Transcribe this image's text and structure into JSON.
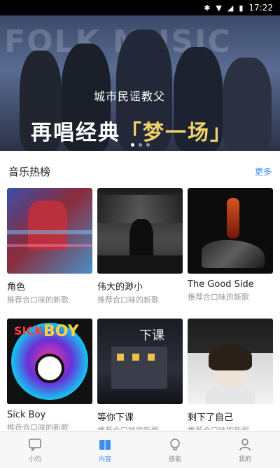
{
  "status_bar": {
    "time": "17:22"
  },
  "banner": {
    "bg_text": "FOLK MUSIC",
    "subtitle": "城市民谣教父",
    "title_main": "再唱经典",
    "title_highlight": "「梦一场」"
  },
  "section": {
    "title": "音乐热榜",
    "more": "更多"
  },
  "cards": [
    {
      "name": "角色",
      "desc": "推荐合口味的新歌"
    },
    {
      "name": "伟大的渺小",
      "desc": "推荐合口味的新歌"
    },
    {
      "name": "The Good Side",
      "desc": "推荐合口味的新歌"
    },
    {
      "name": "Sick Boy",
      "desc": "推荐合口味的新歌"
    },
    {
      "name": "等你下课",
      "desc": "推荐合口味的新歌"
    },
    {
      "name": "剩下了自己",
      "desc": "推荐合口味的新歌"
    }
  ],
  "cover_text": {
    "sick_boy": "BOY",
    "sick_prefix": "SICK",
    "dengni": "下课"
  },
  "tabs": [
    {
      "label": "小灼",
      "icon": "chat-bubble-icon"
    },
    {
      "label": "内容",
      "icon": "book-icon"
    },
    {
      "label": "技能",
      "icon": "lightbulb-icon"
    },
    {
      "label": "我的",
      "icon": "user-icon"
    }
  ],
  "colors": {
    "accent": "#3d8cf0",
    "highlight": "#f1d36b"
  }
}
